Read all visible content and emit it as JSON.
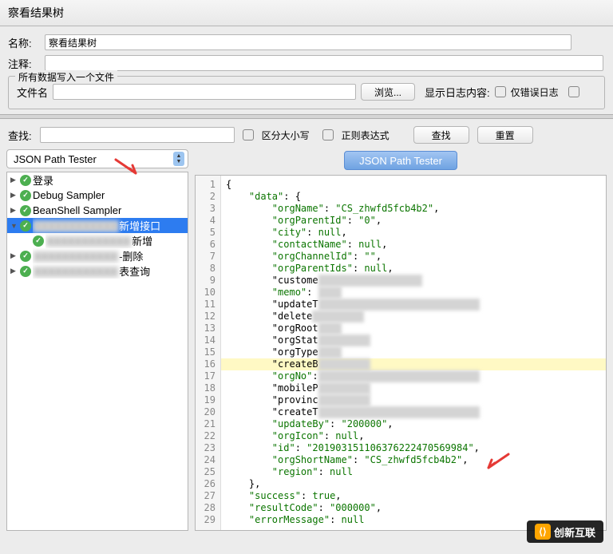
{
  "window_title": "察看结果树",
  "name_field": {
    "label": "名称:",
    "value": "察看结果树"
  },
  "comment_field": {
    "label": "注释:"
  },
  "file_section": {
    "legend": "所有数据写入一个文件",
    "file_label": "文件名",
    "browse_btn": "浏览...",
    "log_label": "显示日志内容:",
    "error_only_label": "仅错误日志"
  },
  "search": {
    "label": "查找:",
    "case_label": "区分大小写",
    "regex_label": "正则表达式",
    "search_btn": "查找",
    "reset_btn": "重置"
  },
  "dropdown_value": "JSON Path Tester",
  "json_btn": "JSON Path Tester",
  "tree": {
    "items": [
      {
        "label": "登录",
        "expandable": true
      },
      {
        "label": "Debug Sampler",
        "expandable": true
      },
      {
        "label": "BeanShell Sampler",
        "expandable": true
      },
      {
        "label": "新增接口",
        "suffix": "新增接口",
        "expandable": true,
        "selected": true,
        "expanded": true
      },
      {
        "label": "新增",
        "suffix": "新增",
        "indent": 1
      },
      {
        "label": "删除",
        "suffix": "-删除",
        "expandable": true
      },
      {
        "label": "表查询",
        "suffix": "表查询",
        "expandable": true
      }
    ]
  },
  "code": {
    "lines": [
      {
        "n": 1,
        "t": "{"
      },
      {
        "n": 2,
        "t": "    \"data\": {"
      },
      {
        "n": 3,
        "t": "        \"orgName\": \"CS_zhwfd5fcb4b2\","
      },
      {
        "n": 4,
        "t": "        \"orgParentId\": \"0\","
      },
      {
        "n": 5,
        "t": "        \"city\": null,"
      },
      {
        "n": 6,
        "t": "        \"contactName\": null,"
      },
      {
        "n": 7,
        "t": "        \"orgChannelId\": \"\","
      },
      {
        "n": 8,
        "t": "        \"orgParentIds\": null,"
      },
      {
        "n": 9,
        "t": "        \"custome",
        "pix": "AAAAAAAA AAAA AAAA"
      },
      {
        "n": 10,
        "t": "        \"memo\": ",
        "pix": "AAAA"
      },
      {
        "n": 11,
        "t": "        \"updateT",
        "pix": "AAAAAAAA AAAA AAAA AAAA AAAA"
      },
      {
        "n": 12,
        "t": "        \"delete",
        "pix": "AAAA AAAA"
      },
      {
        "n": 13,
        "t": "        \"orgRoot",
        "pix": "AAAA"
      },
      {
        "n": 14,
        "t": "        \"orgStat",
        "pix": "AAAA AAAA"
      },
      {
        "n": 15,
        "t": "        \"orgType",
        "pix": "AAAA"
      },
      {
        "n": 16,
        "t": "        \"createB",
        "pix": "AAAA AAAA",
        "hl": true
      },
      {
        "n": 17,
        "t": "        \"orgNo\":",
        "pix": "AAAAAAAA AAAA AAAA AAAA AAAA"
      },
      {
        "n": 18,
        "t": "        \"mobileP",
        "pix": "AAAA AAAA"
      },
      {
        "n": 19,
        "t": "        \"provinc",
        "pix": "AAAA AAAA"
      },
      {
        "n": 20,
        "t": "        \"createT",
        "pix": "AAAAAAAA AAAA AAAA AAAA AAAA"
      },
      {
        "n": 21,
        "t": "        \"updateBy\": \"200000\","
      },
      {
        "n": 22,
        "t": "        \"orgIcon\": null,"
      },
      {
        "n": 23,
        "t": "        \"id\": \"20190315110637622247056998​4\","
      },
      {
        "n": 24,
        "t": "        \"orgShortName\": \"CS_zhwfd5fcb4b2\","
      },
      {
        "n": 25,
        "t": "        \"region\": null"
      },
      {
        "n": 26,
        "t": "    },"
      },
      {
        "n": 27,
        "t": "    \"success\": true,"
      },
      {
        "n": 28,
        "t": "    \"resultCode\": \"000000\","
      },
      {
        "n": 29,
        "t": "    \"errorMessage\": null"
      }
    ]
  },
  "watermark": "创新互联"
}
